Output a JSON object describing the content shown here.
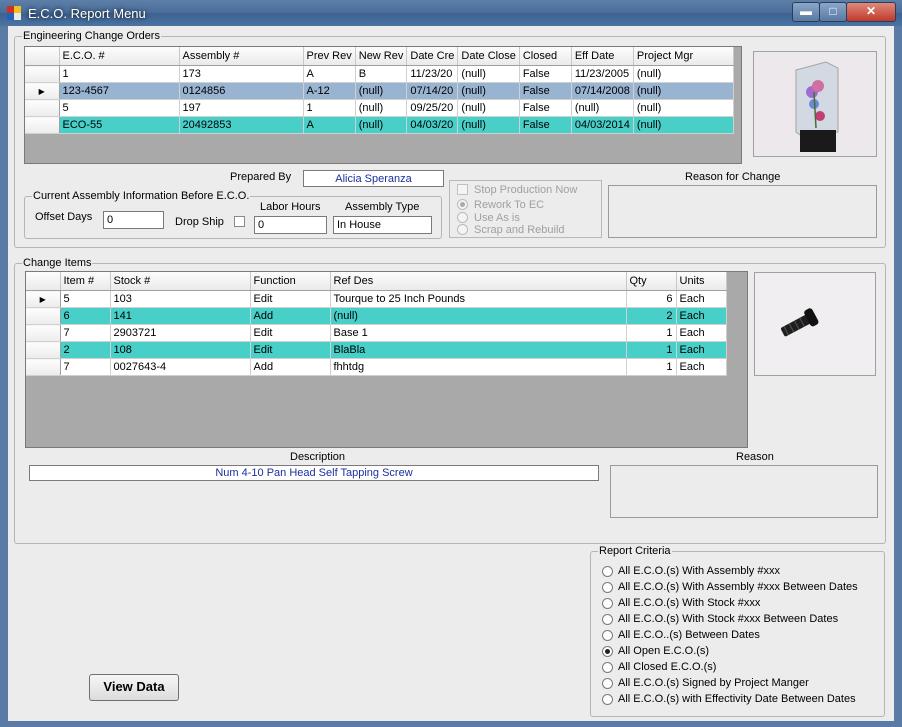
{
  "window": {
    "title": "E.C.O. Report Menu",
    "min_label": "▬",
    "max_label": "□",
    "close_label": "✕"
  },
  "eco_group": {
    "legend": "Engineering Change Orders",
    "columns": [
      "E.C.O. #",
      "Assembly #",
      "Prev Rev",
      "New Rev",
      "Date Cre",
      "Date Close",
      "Closed",
      "Eff Date",
      "Project Mgr"
    ],
    "rows": [
      [
        "1",
        "173",
        "A",
        "B",
        "11/23/20",
        "(null)",
        "False",
        "11/23/2005",
        "(null)"
      ],
      [
        "123-4567",
        "0124856",
        "A-12",
        "(null)",
        "07/14/20",
        "(null)",
        "False",
        "07/14/2008",
        "(null)"
      ],
      [
        "5",
        "197",
        "1",
        "(null)",
        "09/25/20",
        "(null)",
        "False",
        "(null)",
        "(null)"
      ],
      [
        "ECO-55",
        "20492853",
        "A",
        "(null)",
        "04/03/20",
        "(null)",
        "False",
        "04/03/2014",
        "(null)"
      ]
    ],
    "prepared_by_label": "Prepared By",
    "prepared_by_value": "Alicia Speranza",
    "reason_for_change_label": "Reason for Change"
  },
  "current_assembly": {
    "legend": "Current Assembly Information Before E.C.O.",
    "offset_days_label": "Offset Days",
    "offset_days_value": "0",
    "drop_ship_label": "Drop Ship",
    "labor_hours_label": "Labor Hours",
    "labor_hours_value": "0",
    "assembly_type_label": "Assembly Type",
    "assembly_type_value": "In House"
  },
  "disposition": {
    "stop_production_label": "Stop Production Now",
    "rework_label": "Rework To EC",
    "use_as_is_label": "Use As is",
    "scrap_label": "Scrap and Rebuild"
  },
  "change_items": {
    "legend": "Change Items",
    "columns": [
      "Item #",
      "Stock #",
      "Function",
      "Ref Des",
      "Qty",
      "Units"
    ],
    "rows": [
      [
        "5",
        "103",
        "Edit",
        "Tourque to 25 Inch Pounds",
        "6",
        "Each"
      ],
      [
        "6",
        "141",
        "Add",
        "(null)",
        "2",
        "Each"
      ],
      [
        "7",
        "2903721",
        "Edit",
        "Base 1",
        "1",
        "Each"
      ],
      [
        "2",
        "108",
        "Edit",
        "BlaBla",
        "1",
        "Each"
      ],
      [
        "7",
        "0027643-4",
        "Add",
        "fhhtdg",
        "1",
        "Each"
      ]
    ],
    "description_label": "Description",
    "description_value": "Num 4-10  Pan Head Self Tapping Screw",
    "reason_label": "Reason"
  },
  "report_criteria": {
    "legend": "Report Criteria",
    "options": [
      "All E.C.O.(s) With Assembly #xxx",
      "All E.C.O.(s) With Assembly #xxx Between Dates",
      "All E.C.O.(s) With Stock #xxx",
      "All E.C.O.(s) With Stock #xxx Between Dates",
      "All E.C.O..(s) Between Dates",
      "All  Open E.C.O.(s)",
      "All Closed E.C.O.(s)",
      "All E.C.O.(s) Signed by Project Manger",
      "All  E.C.O.(s) with Effectivity Date Between Dates"
    ]
  },
  "actions": {
    "view_data_label": "View Data"
  }
}
